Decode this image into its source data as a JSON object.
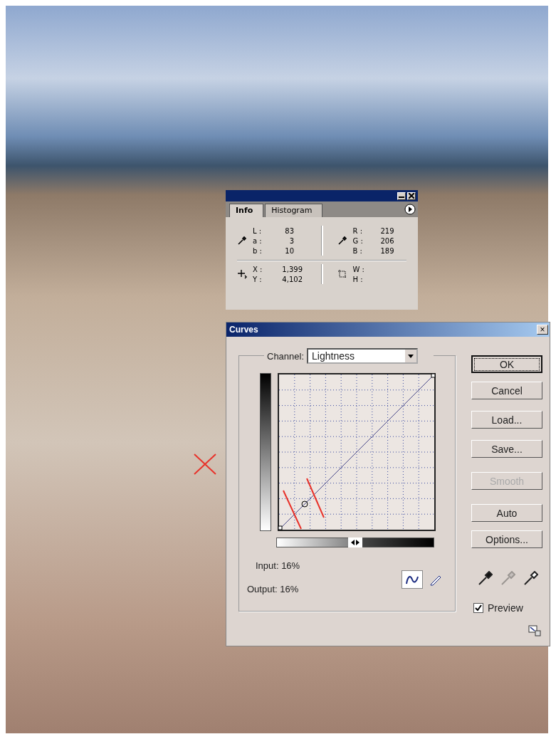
{
  "info_panel": {
    "tabs": [
      {
        "label": "Info",
        "selected": true
      },
      {
        "label": "Histogram",
        "selected": false
      }
    ],
    "lab": [
      {
        "label": "L :",
        "value": "83"
      },
      {
        "label": "a :",
        "value": "3"
      },
      {
        "label": "b :",
        "value": "10"
      }
    ],
    "rgb": [
      {
        "label": "R :",
        "value": "219"
      },
      {
        "label": "G :",
        "value": "206"
      },
      {
        "label": "B :",
        "value": "189"
      }
    ],
    "position": [
      {
        "label": "X :",
        "value": "1,399"
      },
      {
        "label": "Y :",
        "value": "4,102"
      }
    ],
    "size": [
      {
        "label": "W :"
      },
      {
        "label": "H :"
      }
    ]
  },
  "curves_dialog": {
    "title": "Curves",
    "close": "×",
    "channel_label": "Channel:",
    "channel_value": "Lightness",
    "buttons": [
      {
        "label": "OK",
        "default": true,
        "disabled": false
      },
      {
        "label": "Cancel",
        "default": false,
        "disabled": false
      },
      {
        "label": "Load...",
        "default": false,
        "disabled": false
      },
      {
        "label": "Save...",
        "default": false,
        "disabled": false
      },
      {
        "label": "Smooth",
        "default": false,
        "disabled": true
      },
      {
        "label": "Auto",
        "default": false,
        "disabled": false
      },
      {
        "label": "Options...",
        "default": false,
        "disabled": false
      }
    ],
    "input": "Input: 16%",
    "output": "Output: 16%",
    "curve_tools": [
      {
        "kind": "curve",
        "selected": true
      },
      {
        "kind": "pencil",
        "selected": false
      }
    ],
    "eyedroppers": [
      {
        "kind": "black",
        "disabled": false
      },
      {
        "kind": "gray",
        "disabled": true
      },
      {
        "kind": "white",
        "disabled": false
      }
    ],
    "preview": {
      "label": "Preview",
      "checked": true
    }
  }
}
